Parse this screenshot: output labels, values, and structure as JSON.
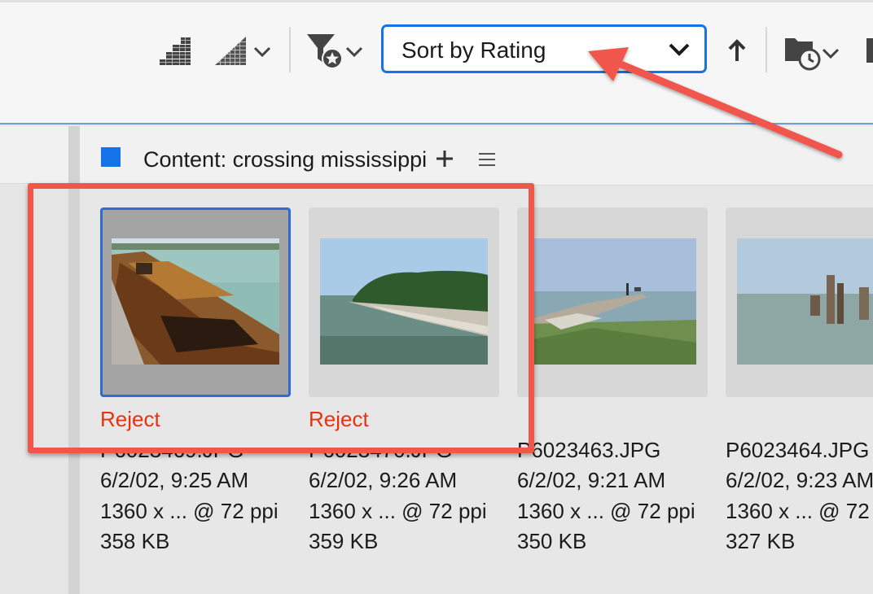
{
  "toolbar": {
    "sort": {
      "selected": "Sort by Rating"
    }
  },
  "icons": {
    "star_rating": "star-rating-icon",
    "star_rating_dropdown": "star-rating-dropdown-icon",
    "filter": "filter-star-icon",
    "sort_direction": "arrow-up-icon",
    "recent_folder": "folder-clock-icon"
  },
  "content": {
    "title": "Content: crossing mississippi"
  },
  "thumbnails": [
    {
      "label": "Reject",
      "filename": "P6023469.JPG",
      "date": "6/2/02, 9:25 AM",
      "dims": "1360 x ... @ 72 ppi",
      "size": "358 KB"
    },
    {
      "label": "Reject",
      "filename": "P6023470.JPG",
      "date": "6/2/02, 9:26 AM",
      "dims": "1360 x ... @ 72 ppi",
      "size": "359 KB"
    },
    {
      "label": "",
      "filename": "P6023463.JPG",
      "date": "6/2/02, 9:21 AM",
      "dims": "1360 x ... @ 72 ppi",
      "size": "350 KB"
    },
    {
      "label": "",
      "filename": "P6023464.JPG",
      "date": "6/2/02, 9:23 AM",
      "dims": "1360 x ... @ 72 ppi",
      "size": "327 KB"
    }
  ],
  "colors": {
    "accent": "#1473e6",
    "reject": "#e5330d",
    "annotation": "#f0574b"
  }
}
